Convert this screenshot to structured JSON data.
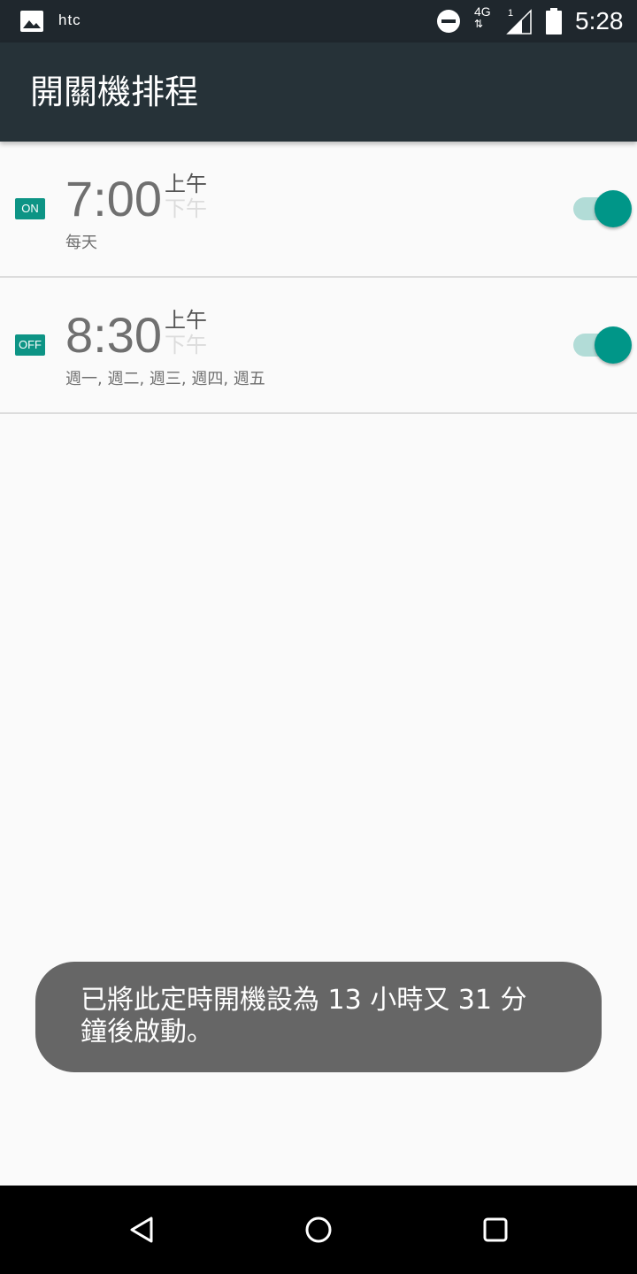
{
  "status_bar": {
    "carrier": "htc",
    "network": "4G",
    "sim_slot": "1",
    "time": "5:28"
  },
  "app_bar": {
    "title": "開關機排程"
  },
  "schedules": [
    {
      "badge": "ON",
      "time": "7:00",
      "am": "上午",
      "pm": "下午",
      "days": "每天",
      "enabled": true
    },
    {
      "badge": "OFF",
      "time": "8:30",
      "am": "上午",
      "pm": "下午",
      "days": "週一, 週二, 週三, 週四, 週五",
      "enabled": true
    }
  ],
  "toast": {
    "line1": "已將此定時開機設為 13 小時又 31 分",
    "line2": "鐘後啟動。"
  },
  "colors": {
    "accent": "#009688",
    "app_bar": "#263238",
    "status_bar": "#1f272d",
    "toast": "#666666"
  },
  "icons": {
    "status": [
      "image-icon",
      "do-not-disturb-icon",
      "signal-icon",
      "battery-icon"
    ],
    "nav": [
      "back-icon",
      "home-icon",
      "recents-icon"
    ]
  }
}
